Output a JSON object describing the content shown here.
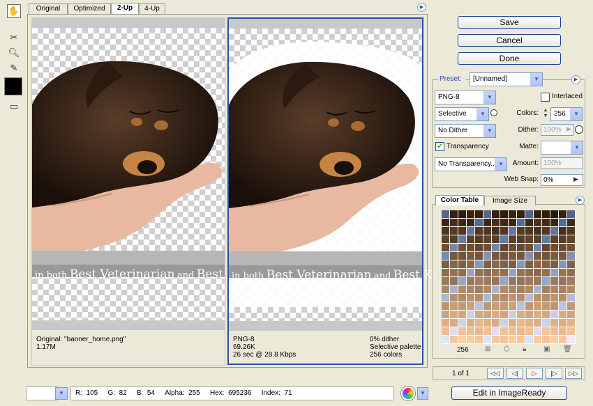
{
  "view_tabs": [
    "Original",
    "Optimized",
    "2-Up",
    "4-Up"
  ],
  "active_view_tab": "2-Up",
  "image_banner": {
    "small1": "in both",
    "big1": "Best Veterinarian",
    "small2": "and",
    "big2": "Best K"
  },
  "original_info": {
    "line1": "Original: \"banner_home.png\"",
    "line2": "1.17M"
  },
  "optimized_info": {
    "format": "PNG-8",
    "size": "69.26K",
    "time": "26 sec @ 28.8 Kbps",
    "dither": "0% dither",
    "palette": "Selective palette",
    "colors": "256 colors"
  },
  "buttons": {
    "save": "Save",
    "cancel": "Cancel",
    "done": "Done",
    "edit": "Edit in ImageReady"
  },
  "settings": {
    "preset_label": "Preset:",
    "preset_value": "[Unnamed]",
    "format": "PNG-8",
    "interlaced_label": "Interlaced",
    "interlaced_checked": false,
    "reduction": "Selective",
    "colors_label": "Colors:",
    "colors_value": "256",
    "dither_algo": "No Dither",
    "dither_label": "Dither:",
    "dither_value": "100%",
    "transparency_label": "Transparency",
    "transparency_checked": true,
    "matte_label": "Matte:",
    "matte_value": "",
    "transparency_dither": "No Transparency...",
    "amount_label": "Amount:",
    "amount_value": "100%",
    "websnap_label": "Web Snap:",
    "websnap_value": "0%"
  },
  "color_table": {
    "tab1": "Color Table",
    "tab2": "Image Size",
    "count": "256"
  },
  "navigation": {
    "page": "1 of 1"
  },
  "status": {
    "r_label": "R:",
    "r": "105",
    "g_label": "G:",
    "g": "82",
    "b_label": "B:",
    "b": "54",
    "alpha_label": "Alpha:",
    "alpha": "255",
    "hex_label": "Hex:",
    "hex": "695236",
    "index_label": "Index:",
    "index": "71"
  },
  "colors": {
    "accent_blue": "#2b4fa8",
    "panel_bg": "#ece9d8",
    "button_border": "#1c3f94"
  }
}
